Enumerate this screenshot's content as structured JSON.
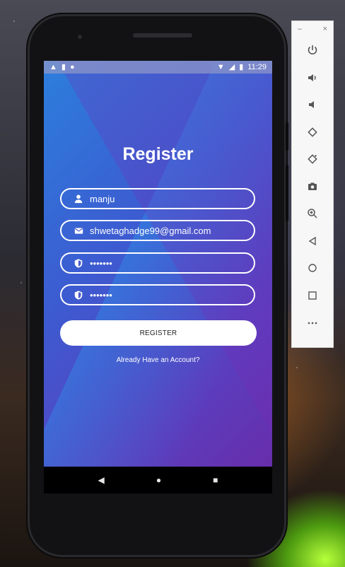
{
  "status_bar": {
    "time": "11:29",
    "left_icons": [
      "warning-icon",
      "sd-card-icon",
      "circle-icon"
    ],
    "right_icons": [
      "wifi-icon",
      "signal-icon",
      "battery-icon"
    ]
  },
  "app": {
    "title": "Register",
    "fields": {
      "name_value": "manju",
      "email_value": "shwetaghadge99@gmail.com",
      "password_value": "•••••••",
      "confirm_password_value": "•••••••"
    },
    "register_label": "REGISTER",
    "login_link": "Already Have an Account?"
  },
  "navbar": {
    "back": "◀",
    "home": "●",
    "recents": "■"
  },
  "emulator_toolbar": {
    "minimize": "–",
    "close": "×",
    "buttons": [
      "power-icon",
      "volume-up-icon",
      "volume-down-icon",
      "rotate-left-icon",
      "rotate-right-icon",
      "camera-icon",
      "zoom-icon",
      "back-icon",
      "home-icon",
      "overview-icon",
      "more-icon"
    ]
  },
  "colors": {
    "gradient_start": "#2c7fdc",
    "gradient_end": "#6a2ba8",
    "field_border": "#ffffff",
    "button_bg": "#ffffff"
  }
}
